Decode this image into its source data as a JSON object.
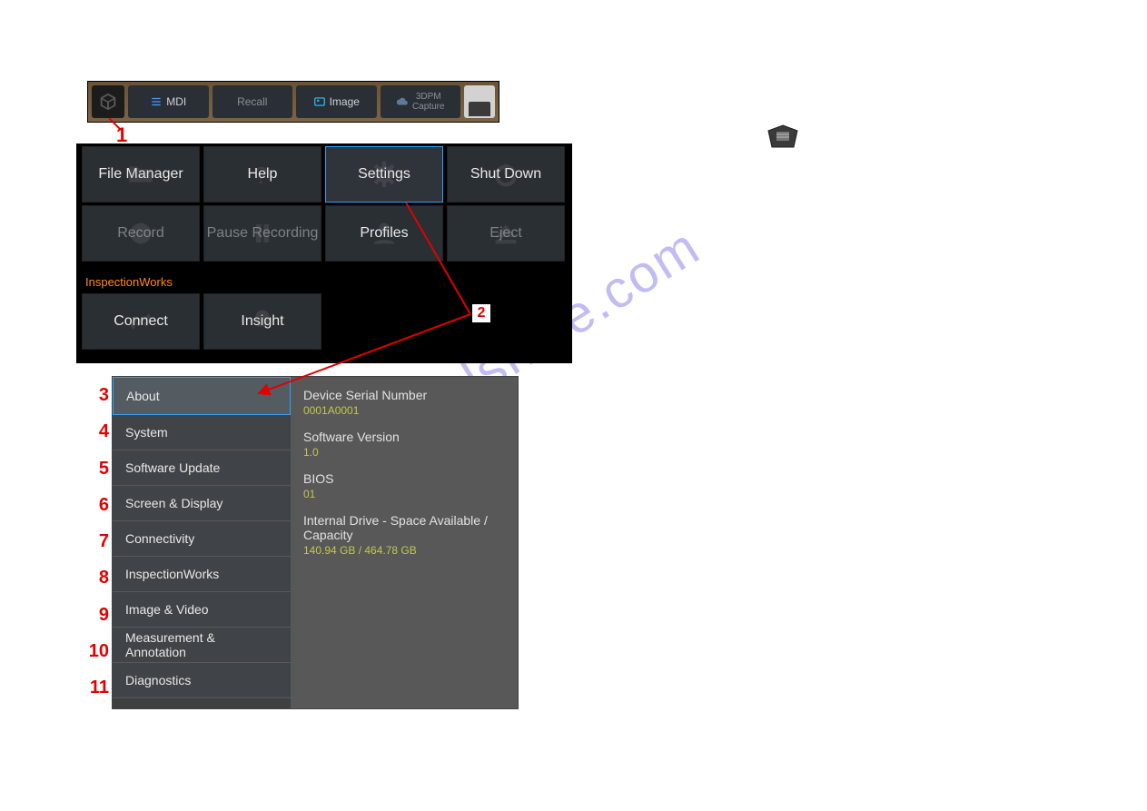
{
  "toolbar": {
    "mdi": "MDI",
    "recall": "Recall",
    "image": "Image",
    "tdpm_line1": "3DPM",
    "tdpm_line2": "Capture"
  },
  "menu": {
    "file_manager": "File Manager",
    "help": "Help",
    "settings": "Settings",
    "shut_down": "Shut Down",
    "record": "Record",
    "pause_recording": "Pause Recording",
    "profiles": "Profiles",
    "eject": "Eject",
    "iw_label": "InspectionWorks",
    "connect": "Connect",
    "insight": "Insight"
  },
  "settings": {
    "side": {
      "about": "About",
      "system": "System",
      "software_update": "Software Update",
      "screen_display": "Screen & Display",
      "connectivity": "Connectivity",
      "inspectionworks": "InspectionWorks",
      "image_video": "Image & Video",
      "measurement": "Measurement & Annotation",
      "diagnostics": "Diagnostics"
    },
    "about": {
      "serial_label": "Device Serial Number",
      "serial_value": "0001A0001",
      "sw_label": "Software Version",
      "sw_value": "1.0",
      "bios_label": "BIOS",
      "bios_value": "01",
      "drive_label": "Internal Drive - Space Available / Capacity",
      "drive_value": "140.94 GB / 464.78 GB"
    }
  },
  "annotations": {
    "n1": "1",
    "n2": "2",
    "n3": "3",
    "n4": "4",
    "n5": "5",
    "n6": "6",
    "n7": "7",
    "n8": "8",
    "n9": "9",
    "n10": "10",
    "n11": "11"
  },
  "watermark": "manualshive.com"
}
